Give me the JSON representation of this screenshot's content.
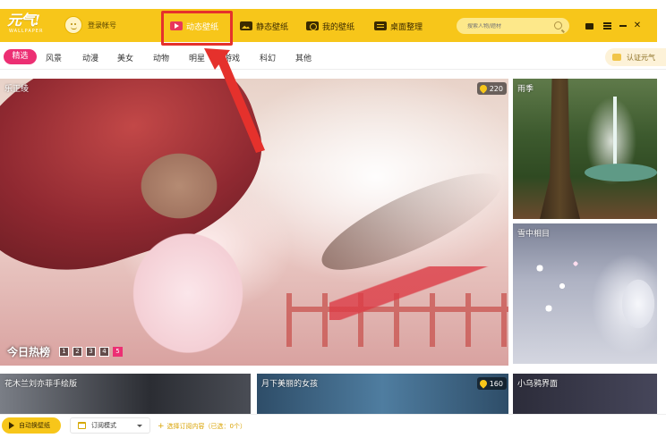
{
  "app": {
    "logo_text": "元气!",
    "logo_sub": "WALLPAPER",
    "login_label": "登录帐号"
  },
  "nav": {
    "tabs": [
      {
        "label": "动态壁纸",
        "icon": "video-play-icon",
        "active": true
      },
      {
        "label": "静态壁纸",
        "icon": "image-icon",
        "active": false
      },
      {
        "label": "我的壁纸",
        "icon": "my-wallpaper-icon",
        "active": false
      },
      {
        "label": "桌面整理",
        "icon": "desktop-organize-icon",
        "active": false
      }
    ]
  },
  "search": {
    "placeholder": "搜索人物/题材"
  },
  "categories": [
    "精选",
    "风景",
    "动漫",
    "美女",
    "动物",
    "明星",
    "游戏",
    "科幻",
    "其他"
  ],
  "certify": {
    "label": "认证元气"
  },
  "hero": {
    "title": "乐正绫",
    "hot_count": "220",
    "ranking_title": "今日热榜",
    "pages": [
      "1",
      "2",
      "3",
      "4",
      "5"
    ],
    "active_page": "5"
  },
  "side_cards": [
    {
      "title": "雨季"
    },
    {
      "title": "雪中相目"
    }
  ],
  "bottom_cards": [
    {
      "title": "花木兰刘亦菲手绘版"
    },
    {
      "title": "月下美丽的女孩",
      "hot_count": "160"
    },
    {
      "title": "小乌鸦界面"
    }
  ],
  "toolbar": {
    "auto_label": "自动换壁纸",
    "mode_label": "订阅模式",
    "subscribe_text": "选择订阅内容（已选：0个）"
  },
  "colors": {
    "brand_yellow": "#f7c61a",
    "accent_pink": "#ec2f73",
    "annotation_red": "#e5312c"
  }
}
